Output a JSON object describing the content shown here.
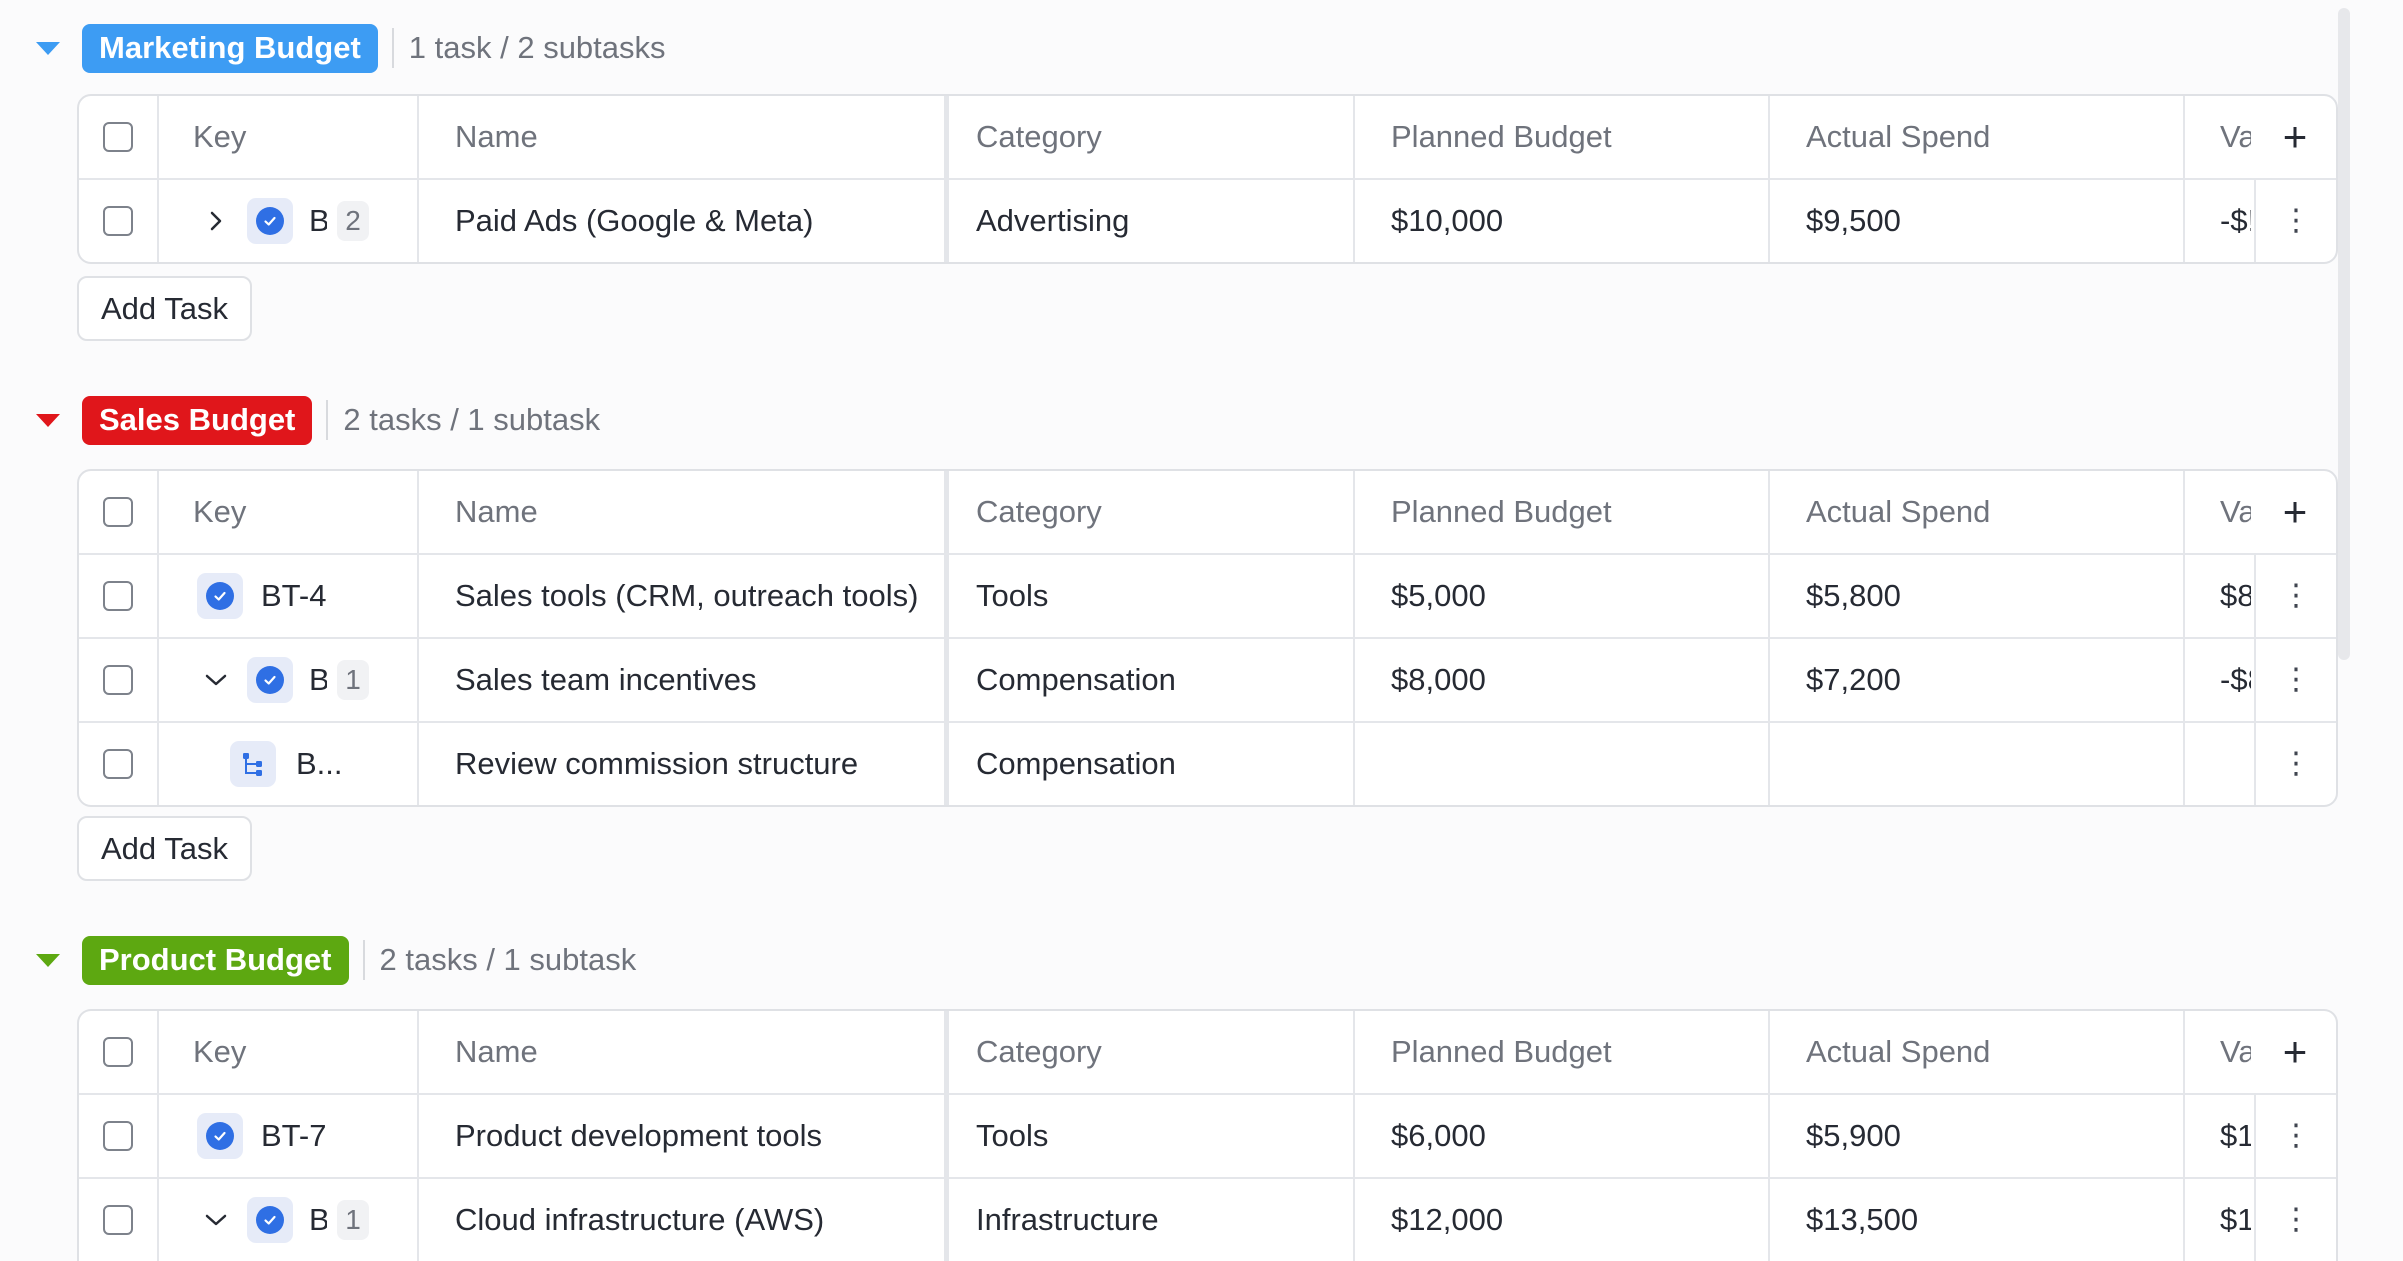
{
  "columns": {
    "key": "Key",
    "name": "Name",
    "category": "Category",
    "planned": "Planned Budget",
    "actual": "Actual Spend",
    "variance": "Va"
  },
  "add_task_label": "Add Task",
  "groups": [
    {
      "title": "Marketing Budget",
      "color": "#3d9cf3",
      "summary": "1 task / 2 subtasks",
      "rows": [
        {
          "key": "B",
          "subtasks": "2",
          "name": "Paid Ads (Google & Meta)",
          "category": "Advertising",
          "planned": "$10,000",
          "actual": "$9,500",
          "variance": "-$!"
        }
      ]
    },
    {
      "title": "Sales Budget",
      "color": "#e0161b",
      "summary": "2 tasks / 1 subtask",
      "rows": [
        {
          "key": "BT-4",
          "name": "Sales tools (CRM, outreach tools)",
          "category": "Tools",
          "planned": "$5,000",
          "actual": "$5,800",
          "variance": "$8"
        },
        {
          "key": "B",
          "subtasks": "1",
          "name": "Sales team incentives",
          "category": "Compensation",
          "planned": "$8,000",
          "actual": "$7,200",
          "variance": "-$8"
        },
        {
          "key": "B...",
          "name": "Review commission structure",
          "category": "Compensation",
          "planned": "",
          "actual": "",
          "variance": ""
        }
      ]
    },
    {
      "title": "Product Budget",
      "color": "#5da811",
      "summary": "2 tasks / 1 subtask",
      "rows": [
        {
          "key": "BT-7",
          "name": "Product development tools",
          "category": "Tools",
          "planned": "$6,000",
          "actual": "$5,900",
          "variance": "$1"
        },
        {
          "key": "B",
          "subtasks": "1",
          "name": "Cloud infrastructure (AWS)",
          "category": "Infrastructure",
          "planned": "$12,000",
          "actual": "$13,500",
          "variance": "$1"
        }
      ]
    }
  ]
}
